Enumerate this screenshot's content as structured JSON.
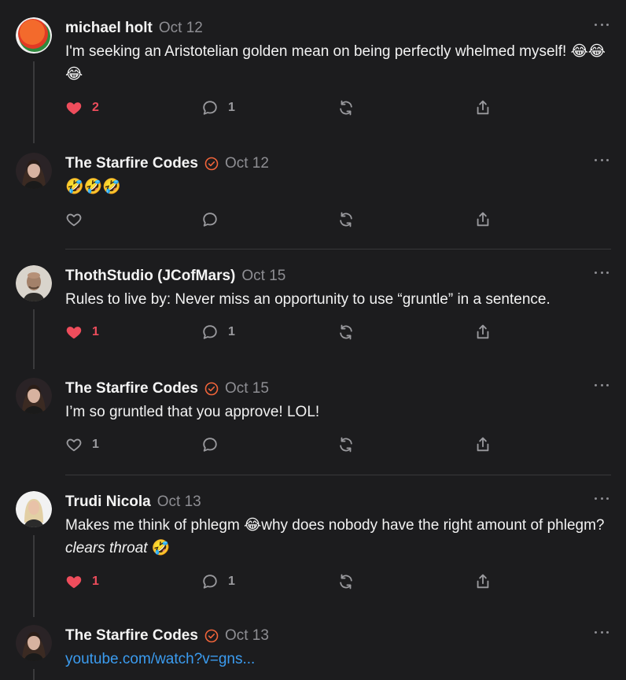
{
  "posts": [
    {
      "author": "michael holt",
      "date": "Oct 12",
      "verified": false,
      "avatar": "orange-green-circle-avatar",
      "text": "I'm seeking an Aristotelian golden mean on being perfectly whelmed myself! 😂😂😂",
      "likes": "2",
      "liked": true,
      "replies": "1"
    },
    {
      "author": "The Starfire Codes",
      "date": "Oct 12",
      "verified": true,
      "avatar": "woman-portrait-avatar",
      "text": "🤣🤣🤣",
      "likes": "",
      "liked": false,
      "replies": ""
    },
    {
      "author": "ThothStudio (JCofMars)",
      "date": "Oct 15",
      "verified": false,
      "avatar": "bald-man-portrait-avatar",
      "text": "Rules to live by: Never miss an opportunity to use “gruntle” in a sentence.",
      "likes": "1",
      "liked": true,
      "replies": "1"
    },
    {
      "author": "The Starfire Codes",
      "date": "Oct 15",
      "verified": true,
      "avatar": "woman-portrait-avatar",
      "text": "I’m so gruntled that you approve! LOL!",
      "likes": "1",
      "liked": false,
      "replies": ""
    },
    {
      "author": "Trudi Nicola",
      "date": "Oct 13",
      "verified": false,
      "avatar": "blonde-woman-portrait-avatar",
      "text_main": "Makes me think of phlegm 😂why does nobody have the right amount of phlegm? ",
      "text_italic": "clears throat",
      "text_tail": " 🤣",
      "likes": "1",
      "liked": true,
      "replies": "1"
    },
    {
      "author": "The Starfire Codes",
      "date": "Oct 13",
      "verified": true,
      "avatar": "woman-portrait-avatar",
      "link_text": "youtube.com/watch?v=gns..."
    }
  ],
  "colors": {
    "background": "#1c1c1e",
    "like_active": "#ee4d5c",
    "verified_badge": "#f0643a",
    "link": "#3b9cf0",
    "muted": "#8e8e93"
  },
  "icons": [
    "heart-icon",
    "comment-icon",
    "repost-icon",
    "share-icon",
    "more-icon",
    "verified-badge-icon"
  ]
}
